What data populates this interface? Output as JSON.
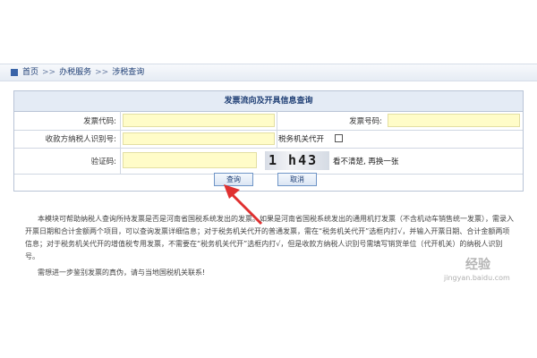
{
  "breadcrumb": {
    "home": "首页",
    "sep": ">>",
    "level1": "办税服务",
    "level2": "涉税查询"
  },
  "form": {
    "title": "发票流向及开具信息查询",
    "invoice_code_label": "发票代码:",
    "invoice_code_value": "",
    "invoice_number_label": "发票号码:",
    "invoice_number_value": "",
    "payer_id_label": "收款方纳税人识别号:",
    "payer_id_value": "",
    "tax_agent_label": "税务机关代开",
    "tax_agent_checked": false,
    "captcha_label": "验证码:",
    "captcha_value": "",
    "captcha_text": "1 h43",
    "captcha_refresh": "看不清楚, 再换一张"
  },
  "buttons": {
    "query": "查询",
    "cancel": "取消"
  },
  "notes": {
    "p1": "本模块可帮助纳税人查询所持发票是否是河南省国税系统发出的发票。如果是河南省国税系统发出的通用机打发票（不含机动车销售统一发票），需录入开票日期和合计金额两个项目，可以查询发票详细信息；对于税务机关代开的普通发票，需在“税务机关代开”选框内打√，并输入开票日期、合计金额两项信息；对于税务机关代开的增值税专用发票，不需要在“税务机关代开”选框内打√，但是收款方纳税人识别号需填写销货单位（代开机关）的纳税人识别号。",
    "p2": "需想进一步鉴别发票的真伪，请与当地国税机关联系!"
  },
  "watermark": {
    "brand": "经验",
    "url": "jingyan.baidu.com"
  },
  "colors": {
    "input_bg": "#fffcc8",
    "title_bar": "#e4ebf5",
    "accent": "#1f3f75",
    "arrow": "#e03030"
  }
}
